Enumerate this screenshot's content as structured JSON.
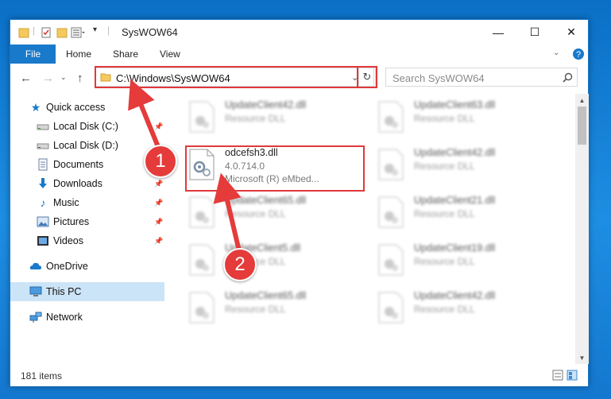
{
  "window": {
    "title": "SysWOW64",
    "controls": {
      "minimize": "—",
      "maximize": "☐",
      "close": "✕"
    }
  },
  "ribbon": {
    "tabs": [
      {
        "label": "File"
      },
      {
        "label": "Home"
      },
      {
        "label": "Share"
      },
      {
        "label": "View"
      }
    ]
  },
  "address": {
    "path": "C:\\Windows\\SysWOW64",
    "search_placeholder": "Search SysWOW64"
  },
  "sidebar": {
    "items": [
      {
        "label": "Quick access",
        "icon": "star-icon"
      },
      {
        "label": "Local Disk (C:)",
        "icon": "drive-icon",
        "pinned": true
      },
      {
        "label": "Local Disk (D:)",
        "icon": "drive-icon",
        "pinned": false
      },
      {
        "label": "Documents",
        "icon": "documents-icon",
        "pinned": true
      },
      {
        "label": "Downloads",
        "icon": "downloads-icon",
        "pinned": true
      },
      {
        "label": "Music",
        "icon": "music-icon",
        "pinned": true
      },
      {
        "label": "Pictures",
        "icon": "pictures-icon",
        "pinned": true
      },
      {
        "label": "Videos",
        "icon": "videos-icon",
        "pinned": true
      },
      {
        "label": "OneDrive",
        "icon": "cloud-icon"
      },
      {
        "label": "This PC",
        "icon": "computer-icon",
        "selected": true
      },
      {
        "label": "Network",
        "icon": "network-icon"
      }
    ]
  },
  "files": {
    "left": [
      {
        "name": "UpdateClient42.dll",
        "desc": "Resource DLL"
      },
      {
        "name": "odcefsh3.dll",
        "version": "4.0.714.0",
        "desc": "Microsoft (R) eMbed..."
      },
      {
        "name": "UpdateClient65.dll",
        "desc": "Resource DLL"
      },
      {
        "name": "UpdateClient5.dll",
        "desc": "Resource DLL"
      },
      {
        "name": "UpdateClient65.dll",
        "desc": "Resource DLL"
      }
    ],
    "right": [
      {
        "name": "UpdateClient63.dll",
        "desc": "Resource DLL"
      },
      {
        "name": "UpdateClient42.dll",
        "desc": "Resource DLL"
      },
      {
        "name": "UpdateClient21.dll",
        "desc": "Resource DLL"
      },
      {
        "name": "UpdateClient19.dll",
        "desc": "Resource DLL"
      },
      {
        "name": "UpdateClient42.dll",
        "desc": "Resource DLL"
      }
    ]
  },
  "status": {
    "item_count": "181 items"
  },
  "annotations": {
    "step1": "1",
    "step2": "2",
    "highlight_color": "#e0393b"
  }
}
